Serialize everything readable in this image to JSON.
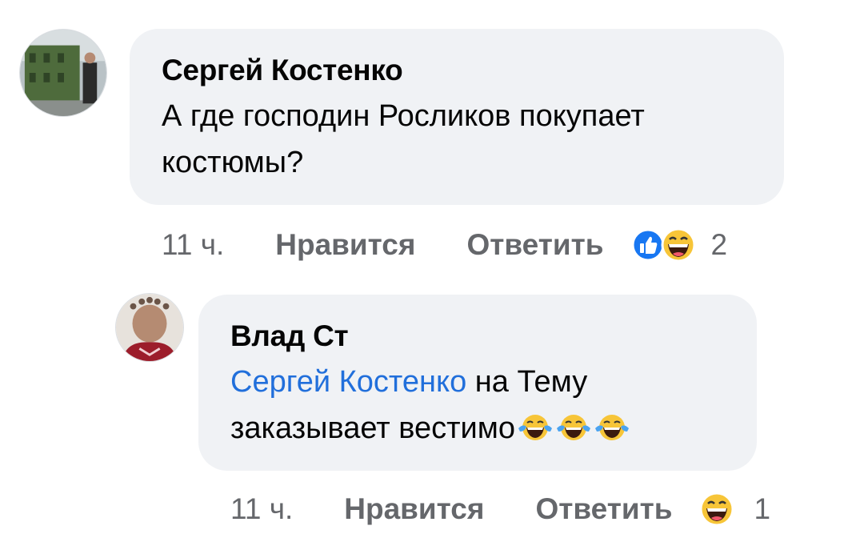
{
  "comments": [
    {
      "author": "Сергей Костенко",
      "text_line1": "А где господин Росликов покупает",
      "text_line2": "костюмы?",
      "time": "11 ч.",
      "like_label": "Нравится",
      "reply_label": "Ответить",
      "reactions": [
        "like-icon",
        "haha-icon"
      ],
      "reaction_count": "2"
    },
    {
      "author": "Влад Ст",
      "mention": "Сергей Костенко",
      "text_after_mention": " на Тему",
      "text_line2": "заказывает вестимо",
      "inline_emoji": [
        "tears-of-joy-emoji",
        "tears-of-joy-emoji",
        "tears-of-joy-emoji"
      ],
      "time": "11 ч.",
      "like_label": "Нравится",
      "reply_label": "Ответить",
      "reactions": [
        "haha-icon"
      ],
      "reaction_count": "1"
    }
  ],
  "colors": {
    "bubble": "#f0f2f5",
    "mention": "#216fdb",
    "meta": "#65676b",
    "like_blue": "#1877f2"
  }
}
